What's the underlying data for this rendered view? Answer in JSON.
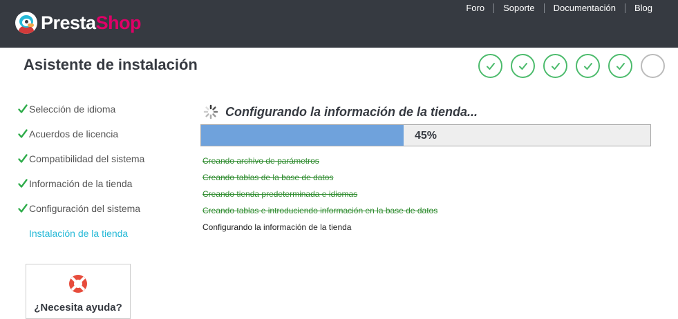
{
  "brand": {
    "logo_part1": "Presta",
    "logo_part2": "Shop",
    "accent": "#df0067",
    "header_bg": "#363a41"
  },
  "topnav": [
    {
      "label": "Foro"
    },
    {
      "label": "Soporte"
    },
    {
      "label": "Documentación"
    },
    {
      "label": "Blog"
    }
  ],
  "page_title": "Asistente de instalación",
  "steps": [
    {
      "status": "done"
    },
    {
      "status": "done"
    },
    {
      "status": "done"
    },
    {
      "status": "done"
    },
    {
      "status": "done"
    },
    {
      "status": "pending"
    }
  ],
  "sidebar": {
    "items": [
      {
        "label": "Selección de idioma",
        "done": true
      },
      {
        "label": "Acuerdos de licencia",
        "done": true
      },
      {
        "label": "Compatibilidad del sistema",
        "done": true
      },
      {
        "label": "Información de la tienda",
        "done": true
      },
      {
        "label": "Configuración del sistema",
        "done": true
      },
      {
        "label": "Instalación de la tienda",
        "done": false,
        "active": true
      }
    ]
  },
  "help": {
    "label": "¿Necesita ayuda?",
    "icon": "lifebuoy-icon"
  },
  "install": {
    "heading": "Configurando la información de la tienda...",
    "progress_percent": 45,
    "progress_label": "45%",
    "progress_color": "#6fa2dc",
    "log": [
      {
        "text": "Creando archivo de parámetros",
        "status": "done"
      },
      {
        "text": "Creando tablas de la base de datos",
        "status": "done"
      },
      {
        "text": "Creando tienda predeterminada e idiomas",
        "status": "done"
      },
      {
        "text": "Creando tablas e introduciendo información en la base de datos",
        "status": "done"
      },
      {
        "text": "Configurando la información de la tienda",
        "status": "current"
      }
    ]
  },
  "colors": {
    "check_green": "#4cbb6c",
    "active_link": "#25b9d7",
    "log_done": "#2e8b2e"
  }
}
